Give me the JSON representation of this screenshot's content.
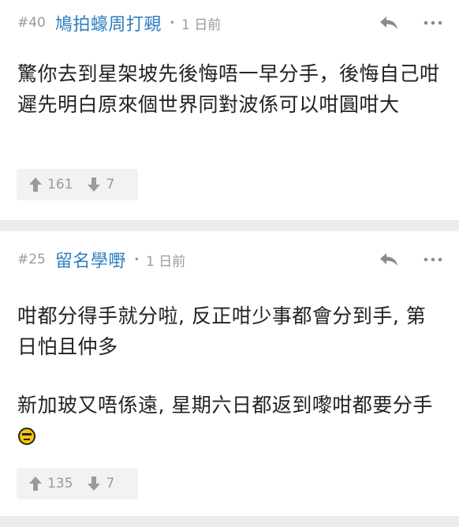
{
  "comments": [
    {
      "floor": "#40",
      "username": "鳩拍蠔周打覡",
      "separator": "•",
      "time": "1 日前",
      "paragraphs": [
        "驚你去到星架坡先後悔唔一早分手，後悔自己咁遲先明白原來個世界同對波係可以咁圓咁大"
      ],
      "upvotes": "161",
      "downvotes": "7"
    },
    {
      "floor": "#25",
      "username": "留名學嘢",
      "separator": "•",
      "time": "1 日前",
      "paragraphs": [
        "咁都分得手就分啦, 反正咁少事都會分到手, 第日怕且仲多",
        "新加玻又唔係遠, 星期六日都返到嚟咁都要分手"
      ],
      "emoji_icon": "sunglasses-smirk-emoji",
      "upvotes": "135",
      "downvotes": "7"
    }
  ],
  "colors": {
    "username": "#2f7fc0",
    "meta": "#9a9a9a",
    "background": "#ececec",
    "vote_box": "#f2f2f2",
    "emoji": "#f7c600"
  },
  "icons": {
    "reply": "reply-arrow-icon",
    "more": "more-dots-icon",
    "upvote": "arrow-up-icon",
    "downvote": "arrow-down-icon"
  }
}
